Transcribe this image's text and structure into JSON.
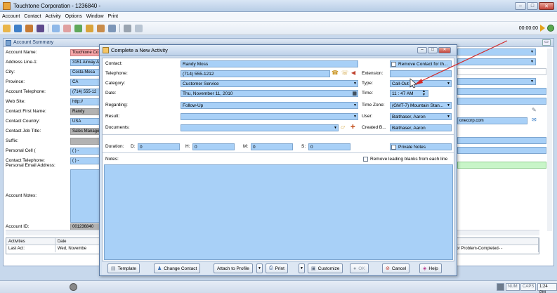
{
  "window": {
    "title": "Touchtone Corporation - 1236840 -"
  },
  "menu": [
    "Account",
    "Contact",
    "Activity",
    "Options",
    "Window",
    "Print"
  ],
  "toolbar": {
    "timer": "00:00:00"
  },
  "account_summary": {
    "title": "Account Summary",
    "rows": [
      {
        "label": "Account Name:",
        "value": "Touchtone Co",
        "style": "pink"
      },
      {
        "label": "Address Line-1:",
        "value": "3151 Airway A",
        "style": "blue"
      },
      {
        "label": "City:",
        "value": "Costa Mesa",
        "style": "blue"
      },
      {
        "label": "Province:",
        "value": "CA",
        "style": "blue"
      },
      {
        "label": "Account Telephone:",
        "value": "(714) 555-12",
        "style": "blue"
      },
      {
        "label": "Web Site:",
        "value": "http://",
        "style": "blue"
      },
      {
        "label": "Contact First Name:",
        "value": "Randy",
        "style": "gray"
      },
      {
        "label": "Contact Country:",
        "value": "USA",
        "style": "blue"
      },
      {
        "label": "Contact Job Title:",
        "value": "Sales Manage",
        "style": "gray"
      },
      {
        "label": "Suffix:",
        "value": "",
        "style": "gray"
      },
      {
        "label": "Personal Cell (",
        "value": "(    )    -",
        "style": "blue"
      },
      {
        "label": "Contact Telephone:",
        "value": "(    )    -",
        "style": "blue"
      },
      {
        "label": "Personal Email Address:",
        "value": "",
        "style": "gray"
      }
    ],
    "notes_label": "Account Notes:",
    "account_id_label": "Account ID:",
    "account_id": "001236840",
    "email_partial": "onecorp.com",
    "grid": {
      "headers": [
        "Activities",
        "Date"
      ],
      "row": [
        "Last Act:",
        "Wed, Novembe"
      ],
      "right_text": "ncident or Problem-Completed- -"
    }
  },
  "dialog": {
    "title": "Complete a New Activity",
    "labels": {
      "contact": "Contact:",
      "telephone": "Telephone:",
      "category": "Category:",
      "date": "Date:",
      "regarding": "Regarding:",
      "result": "Result:",
      "documents": "Documents:",
      "extension": "Extension:",
      "type": "Type:",
      "time": "Time:",
      "timezone": "Time Zone:",
      "user": "User:",
      "created_by": "Created B...",
      "duration": "Duration:",
      "d": "D:",
      "h": "H:",
      "m": "M:",
      "s": "S:",
      "notes": "Notes:"
    },
    "values": {
      "contact": "Randy Moss",
      "telephone": "(714) 555-1212",
      "category": "Customer Service",
      "date": "Thu, November 11, 2010",
      "regarding": "Follow-Up",
      "result": "",
      "documents": "",
      "extension": "",
      "type": "Call-Out",
      "time": "11 : 47   AM",
      "timezone": "(GMT-7) Mountain Stan...",
      "user": "Balthaser, Aaron",
      "created_by": "Balthaser, Aaron",
      "d": "0",
      "h": "0",
      "m": "0",
      "s": "0"
    },
    "checkboxes": {
      "remove_contact": "Remove Contact for th...",
      "private_notes": "Private Notes",
      "remove_blanks": "Remove leading blanks from each line"
    },
    "buttons": {
      "template": "Template",
      "change_contact": "Change Contact",
      "attach": "Attach to Profile",
      "print": "Print",
      "customize": "Customize",
      "ok": "OK",
      "cancel": "Cancel",
      "help": "Help"
    }
  },
  "statusbar": {
    "num": "NUM",
    "caps": "CAPS",
    "clock": "1:24 PM"
  }
}
